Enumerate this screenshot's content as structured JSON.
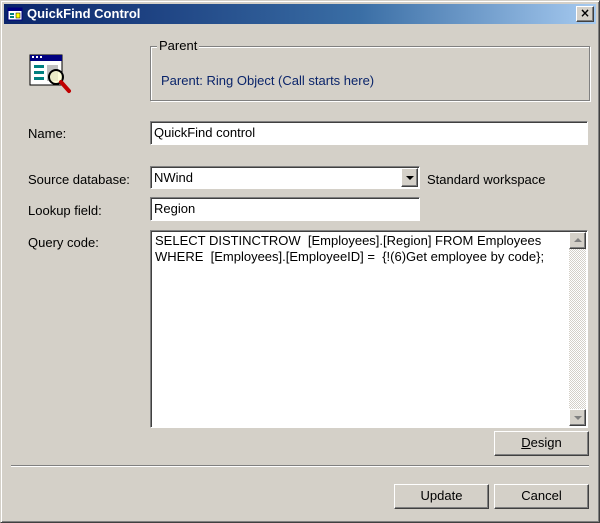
{
  "window": {
    "title": "QuickFind Control",
    "close_label": "×"
  },
  "icons": {
    "app": "query-control-icon",
    "big": "form-search-icon"
  },
  "parent": {
    "group_title": "Parent",
    "text": "Parent: Ring Object (Call starts here)"
  },
  "form": {
    "name_label": "Name:",
    "name_value": "QuickFind control",
    "source_label": "Source database:",
    "source_value": "NWind",
    "workspace_text": "Standard workspace",
    "lookup_label": "Lookup field:",
    "lookup_value": "Region",
    "query_label": "Query code:",
    "query_value": "SELECT DISTINCTROW  [Employees].[Region] FROM Employees WHERE  [Employees].[EmployeeID] =  {!(6)Get employee by code};"
  },
  "buttons": {
    "design": "Design",
    "update": "Update",
    "cancel": "Cancel"
  },
  "colors": {
    "titlebar_start": "#0a246a",
    "titlebar_end": "#a6caf0",
    "dialog_bg": "#d4d0c8",
    "parent_text": "#0a246a"
  }
}
